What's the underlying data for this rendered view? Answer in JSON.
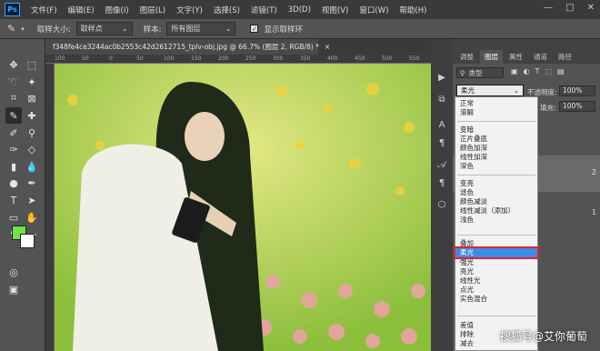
{
  "app_logo": "Ps",
  "menubar": [
    "文件(F)",
    "编辑(E)",
    "图像(I)",
    "图层(L)",
    "文字(Y)",
    "选择(S)",
    "滤镜(T)",
    "3D(D)",
    "视图(V)",
    "窗口(W)",
    "帮助(H)"
  ],
  "window_controls": [
    "—",
    "□",
    "✕"
  ],
  "options": {
    "sample_size_label": "取样大小:",
    "sample_size_value": "取样点",
    "sample_label": "样本:",
    "sample_value": "所有图层",
    "show_ring_label": "显示取样环",
    "show_ring_checked": true
  },
  "document": {
    "tab_title": "f348fe4ce3244ac0b2553c42d2612715_tplv-obj.jpg @ 66.7% (图层 2, RGB/8) *",
    "close": "×",
    "ruler_ticks": [
      "100",
      "50",
      "0",
      "50",
      "100",
      "150",
      "200",
      "250",
      "300",
      "350",
      "400",
      "450",
      "500",
      "550"
    ]
  },
  "panel": {
    "tabs": [
      "调整",
      "图层",
      "属性",
      "通道",
      "路径"
    ],
    "active_tab": "图层",
    "kind_label": "类型",
    "opacity_label": "不透明度:",
    "opacity_value": "100%",
    "fill_label": "填充:",
    "fill_value": "100%",
    "layer_num_a": "2",
    "layer_num_b": "1"
  },
  "blend_mode": {
    "current": "柔光",
    "groups": [
      [
        "正常",
        "溶解"
      ],
      [
        "变暗",
        "正片叠底",
        "颜色加深",
        "线性加深",
        "深色"
      ],
      [
        "变亮",
        "滤色",
        "颜色减淡",
        "线性减淡（添加）",
        "浅色"
      ],
      [
        "叠加",
        "柔光",
        "强光",
        "亮光",
        "线性光",
        "点光",
        "实色混合"
      ],
      [
        "差值",
        "排除",
        "减去"
      ]
    ],
    "selected": "柔光"
  },
  "watermark": "搜狐号@艾你葡萄",
  "colors": {
    "foreground": "#6ee04a",
    "background": "#ffffff",
    "selection": "#3b8ce6",
    "highlight_box": "#e0242a"
  }
}
